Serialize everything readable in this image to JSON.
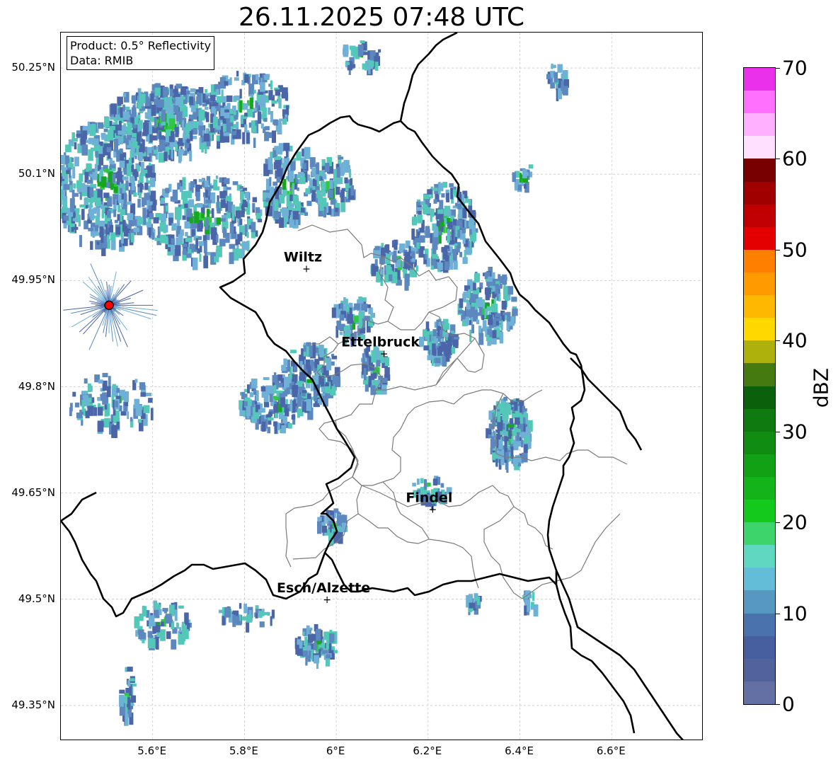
{
  "title": "26.11.2025 07:48 UTC",
  "info_box": {
    "product": "Product: 0.5° Reflectivity",
    "data_source": "Data: RMIB"
  },
  "axes": {
    "lat_labels": [
      "50.25°N",
      "50.1°N",
      "49.95°N",
      "49.8°N",
      "49.65°N",
      "49.5°N",
      "49.35°N"
    ],
    "lon_labels": [
      "5.6°E",
      "5.8°E",
      "6°E",
      "6.2°E",
      "6.4°E",
      "6.6°E"
    ],
    "lon_range": [
      5.4,
      6.8
    ],
    "lat_range": [
      49.3,
      50.3
    ],
    "grid": true
  },
  "cities": [
    {
      "name": "Wiltz",
      "lon": 5.935,
      "lat": 49.967
    },
    {
      "name": "Ettelbruck",
      "lon": 6.104,
      "lat": 49.847
    },
    {
      "name": "Findel",
      "lon": 6.21,
      "lat": 49.627
    },
    {
      "name": "Esch/Alzette",
      "lon": 5.98,
      "lat": 49.5
    }
  ],
  "radar_site": {
    "lon": 5.505,
    "lat": 49.915,
    "color": "#ff0000"
  },
  "colorbar": {
    "unit": "dBZ",
    "min": 0,
    "max": 70,
    "tick_labels": [
      "70",
      "60",
      "50",
      "40",
      "30",
      "20",
      "10",
      "0"
    ],
    "colors": [
      "#646fa3",
      "#52639c",
      "#475e9f",
      "#4a72ad",
      "#5698c2",
      "#64bdd8",
      "#5ed8c0",
      "#3dd46c",
      "#12c91c",
      "#13b419",
      "#12a014",
      "#108c12",
      "#0e7a10",
      "#0b600b",
      "#447a10",
      "#aeb00c",
      "#ffd800",
      "#ffb800",
      "#ff9b00",
      "#ff7f00",
      "#e40000",
      "#c00000",
      "#a00000",
      "#780000",
      "#ffe0ff",
      "#ffb0ff",
      "#ff70ff",
      "#ea30ea"
    ]
  },
  "echo_palette": [
    "#4a66a8",
    "#5c88bf",
    "#6fb0d6",
    "#53c8b8",
    "#2fc840",
    "#15a81b"
  ],
  "colors": {
    "border_national": "#000000",
    "border_canton": "#7a7a7a",
    "grid": "#c8c8c8"
  }
}
